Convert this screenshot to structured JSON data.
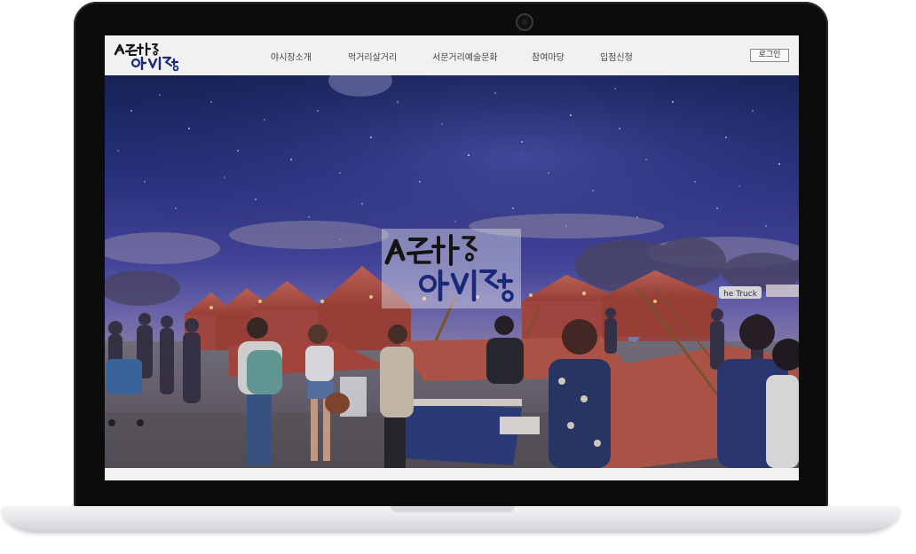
{
  "brand": {
    "logo_alt": "서문시장 야시장"
  },
  "header": {
    "nav": [
      "야시장소개",
      "먹거리살거리",
      "서문거리예술문화",
      "참여마당",
      "입점신청"
    ],
    "login_label": "로그인"
  },
  "colors": {
    "sky_top": "#1d2a6a",
    "sky_mid": "#3c3e98",
    "tent": "#c0574a",
    "bezel": "#0c0c0c"
  }
}
